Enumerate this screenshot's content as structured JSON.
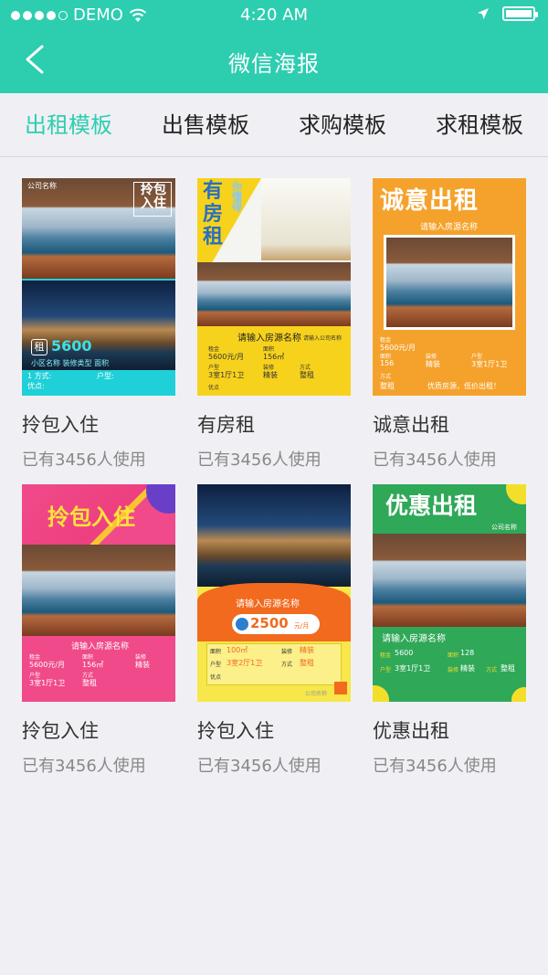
{
  "status_bar": {
    "carrier": "DEMO",
    "time": "4:20 AM"
  },
  "header": {
    "title": "微信海报"
  },
  "tabs": [
    {
      "label": "出租模板",
      "active": true
    },
    {
      "label": "出售模板",
      "active": false
    },
    {
      "label": "求购模板",
      "active": false
    },
    {
      "label": "求租模板",
      "active": false
    }
  ],
  "templates": [
    {
      "title": "拎包入住",
      "usage": "已有3456人使用",
      "poster": {
        "company": "公司名称",
        "headline": "拎包入住",
        "tag": "租",
        "price": "5600",
        "line1": "小区名称 装修类型 面积",
        "field1": "1 方式:",
        "field2": "户型:",
        "field3": "优点:"
      }
    },
    {
      "title": "有房租",
      "usage": "已有3456人使用",
      "poster": {
        "headline": "有房租",
        "sub": "你懂得",
        "name": "请输入房源名称",
        "company": "请输入公司名称",
        "k_rent": "租金",
        "v_rent": "5600元/月",
        "k_area": "面积",
        "v_area": "156㎡",
        "k_type": "户型",
        "v_type": "3室1厅1卫",
        "k_deco": "装修",
        "v_deco": "精装",
        "k_mode": "方式",
        "v_mode": "整租",
        "k_adv": "优点"
      }
    },
    {
      "title": "诚意出租",
      "usage": "已有3456人使用",
      "poster": {
        "headline": "诚意出租",
        "name": "请输入房源名称",
        "k_rent": "租金",
        "v_rent": "5600元/月",
        "k_area": "面积",
        "v_area": "156",
        "k_deco": "装修",
        "v_deco": "精装",
        "k_type": "户型",
        "v_type": "3室1厅1卫",
        "k_mode": "方式",
        "v_mode": "整租",
        "slogan": "优质房源，低价出租！"
      }
    },
    {
      "title": "拎包入住",
      "usage": "已有3456人使用",
      "poster": {
        "headline": "拎包入住",
        "name": "请输入房源名称",
        "k_rent": "租金",
        "v_rent": "5600元/月",
        "k_area": "面积",
        "v_area": "156㎡",
        "k_deco": "装修",
        "v_deco": "精装",
        "k_type": "户型",
        "v_type": "3室1厅1卫",
        "k_mode": "方式",
        "v_mode": "整租"
      }
    },
    {
      "title": "拎包入住",
      "usage": "已有3456人使用",
      "poster": {
        "name": "请输入房源名称",
        "price": "2500",
        "unit": "元/月",
        "k_area": "面积",
        "v_area": "100㎡",
        "k_deco": "装修",
        "v_deco": "精装",
        "k_type": "户型",
        "v_type": "3室2厅1卫",
        "k_mode": "方式",
        "v_mode": "整租",
        "k_adv": "优点",
        "company": "公司名称"
      }
    },
    {
      "title": "优惠出租",
      "usage": "已有3456人使用",
      "poster": {
        "headline": "优惠出租",
        "company": "公司名称",
        "name": "请输入房源名称",
        "k_rent": "租金",
        "v_rent": "5600",
        "k_area": "面积",
        "v_area": "128",
        "k_type": "户型",
        "v_type": "3室1厅1卫",
        "k_deco": "装修",
        "v_deco": "精装",
        "k_mode": "方式",
        "v_mode": "整租"
      }
    }
  ],
  "colors": {
    "accent": "#2dcdb0"
  }
}
